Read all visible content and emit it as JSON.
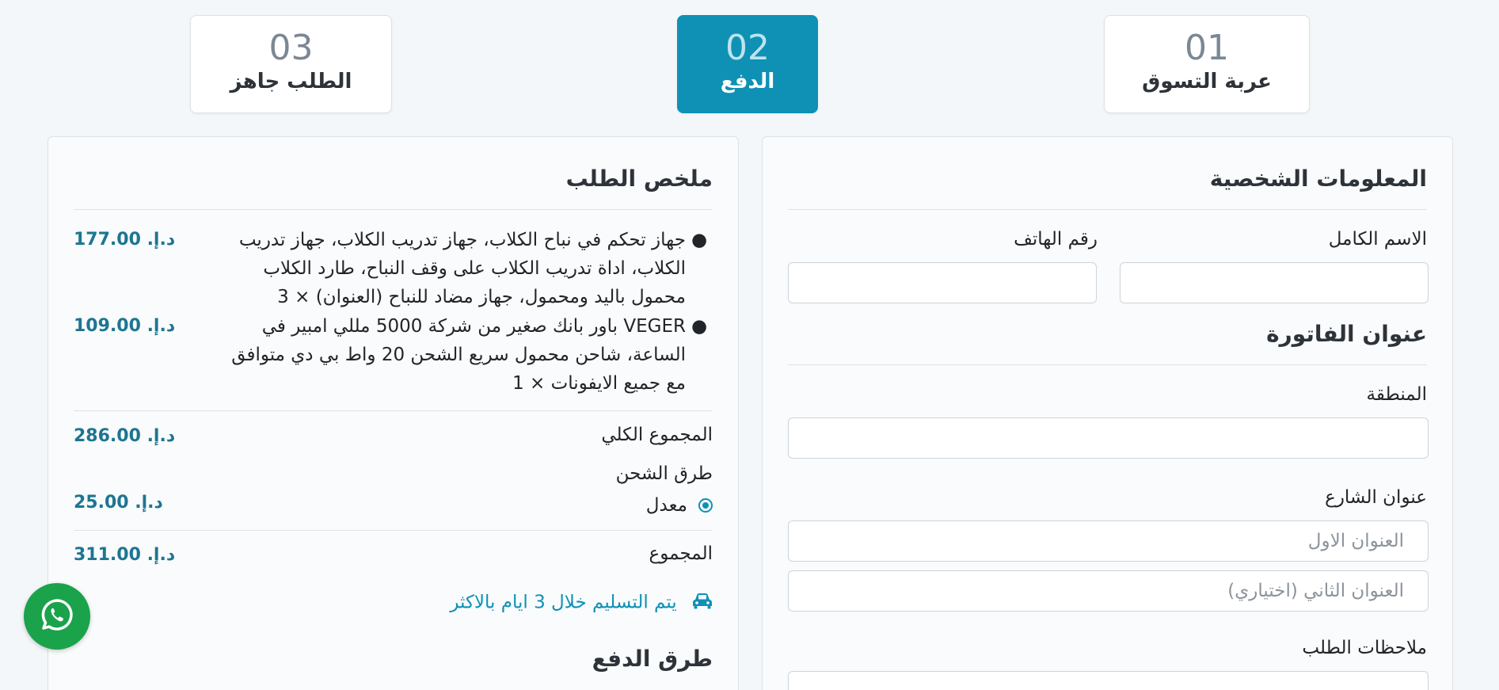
{
  "steps": [
    {
      "num": "01",
      "label": "عربة التسوق"
    },
    {
      "num": "02",
      "label": "الدفع"
    },
    {
      "num": "03",
      "label": "الطلب جاهز"
    }
  ],
  "personal": {
    "title": "المعلومات الشخصية",
    "full_name_label": "الاسم الكامل",
    "phone_label": "رقم الهاتف",
    "full_name_value": "",
    "phone_value": ""
  },
  "billing": {
    "title": "عنوان الفاتورة",
    "region_label": "المنطقة",
    "region_value": "",
    "street_label": "عنوان الشارع",
    "address1_placeholder": "العنوان الاول",
    "address2_placeholder": "العنوان الثاني (اختياري)",
    "notes_label": "ملاحظات الطلب"
  },
  "summary": {
    "title": "ملخص الطلب",
    "items": [
      {
        "text": "جهاز تحكم في نباح الكلاب، جهاز تدريب الكلاب، جهاز تدريب الكلاب، اداة تدريب الكلاب على وقف النباح، طارد الكلاب محمول باليد ومحمول، جهاز مضاد للنباح (العنوان) × 3",
        "price": "د.إ. 177.00"
      },
      {
        "text": "VEGER باور بانك صغير من شركة 5000 مللي امبير في الساعة، شاحن محمول سريع الشحن 20 واط بي دي متوافق مع جميع الايفونات × 1",
        "price": "د.إ. 109.00"
      }
    ],
    "subtotal_label": "المجموع الكلي",
    "subtotal_value": "د.إ. 286.00",
    "shipping_label": "طرق الشحن",
    "shipping_option": "معدل",
    "shipping_value": "د.إ. 25.00",
    "total_label": "المجموع",
    "total_value": "د.إ. 311.00",
    "delivery_note": "يتم التسليم خلال 3 ايام بالاكثر",
    "payment_title": "طرق الدفع"
  },
  "icons": {
    "delivery": "car-icon",
    "whatsapp": "whatsapp-icon"
  },
  "colors": {
    "accent": "#0e91b5",
    "price": "#1d7592",
    "whatsapp": "#1aa34a"
  }
}
